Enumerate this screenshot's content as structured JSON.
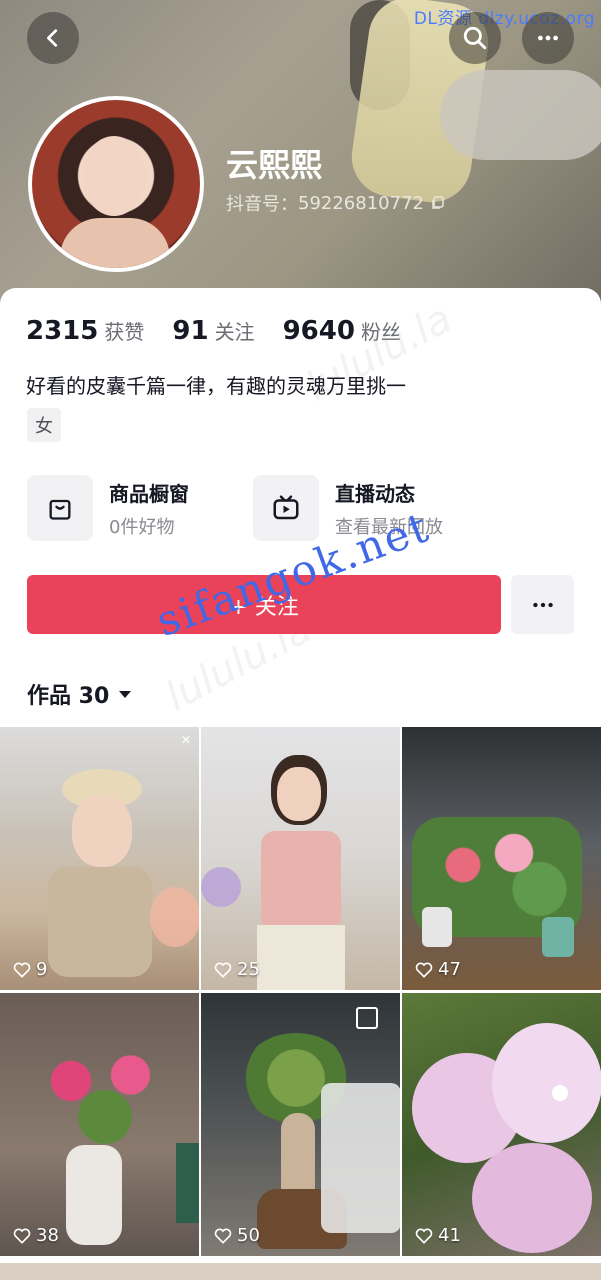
{
  "header": {
    "watermark": "DL资源  dlzy.ucoz.org",
    "back_icon": "chevron-left-icon",
    "search_icon": "search-icon",
    "more_icon": "more-horizontal-icon"
  },
  "profile": {
    "name": "云熙熙",
    "douyin_id_label": "抖音号：",
    "douyin_id": "59226810772",
    "copy_icon": "copy-icon"
  },
  "stats": [
    {
      "value": "2315",
      "label": "获赞"
    },
    {
      "value": "91",
      "label": "关注"
    },
    {
      "value": "9640",
      "label": "粉丝"
    }
  ],
  "bio": "好看的皮囊千篇一律，有趣的灵魂万里挑一",
  "gender_tag": "女",
  "features": [
    {
      "title": "商品橱窗",
      "subtitle": "0件好物",
      "icon": "shopping-bag-icon"
    },
    {
      "title": "直播动态",
      "subtitle": "查看最新回放",
      "icon": "tv-play-icon"
    }
  ],
  "actions": {
    "follow_label": "+ 关注",
    "more_icon": "more-horizontal-icon"
  },
  "works": {
    "tab_label": "作品 30",
    "watermark": "sifangok.net",
    "items": [
      {
        "likes": "9"
      },
      {
        "likes": "25"
      },
      {
        "likes": "47"
      },
      {
        "likes": "38"
      },
      {
        "likes": "50"
      },
      {
        "likes": "41"
      }
    ]
  },
  "colors": {
    "accent": "#ea4359",
    "text_primary": "#161823",
    "text_secondary": "#8a8b91"
  }
}
